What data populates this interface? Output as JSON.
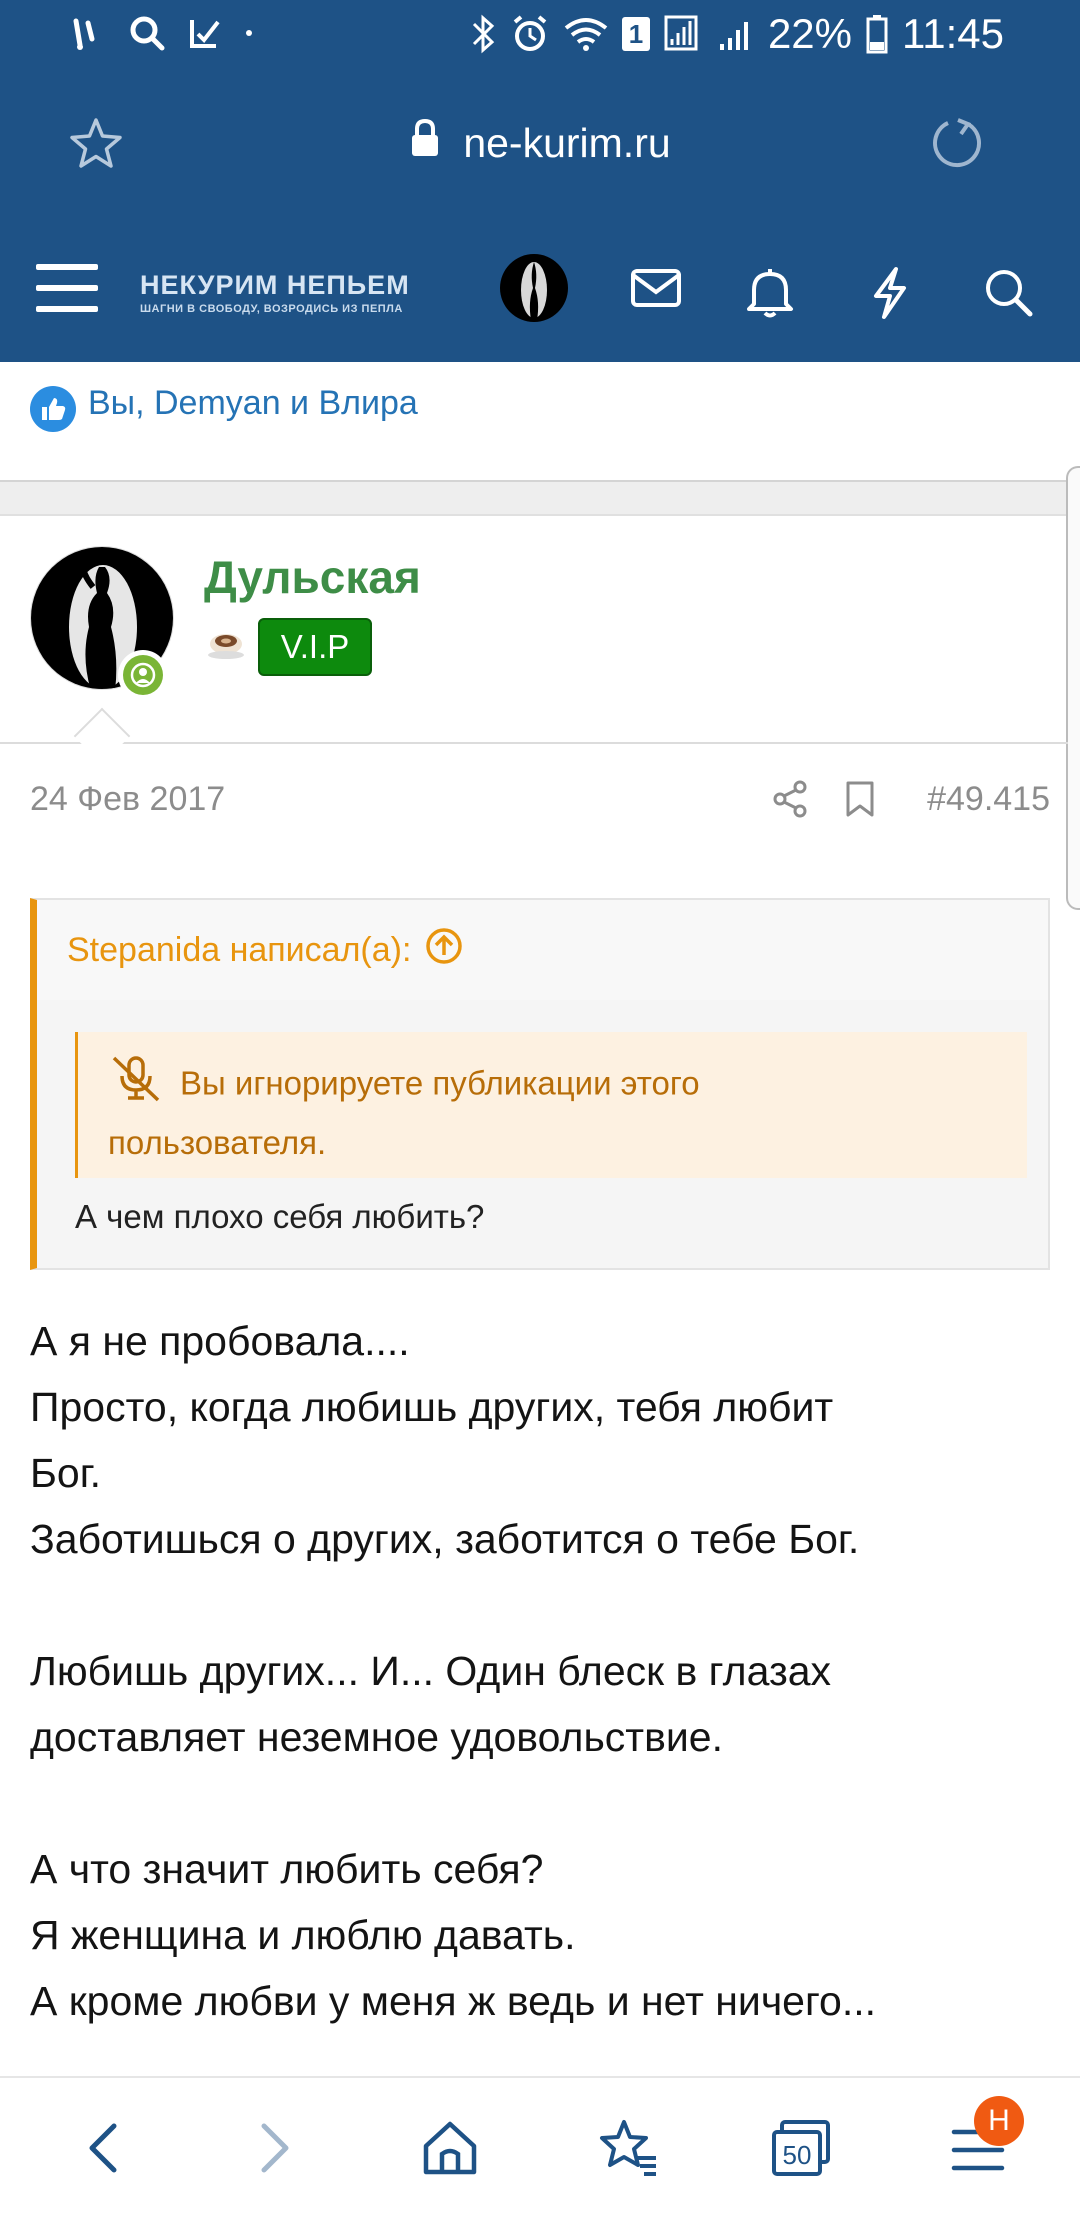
{
  "status_bar": {
    "battery": "22%",
    "time": "11:45",
    "sim_badge": "1"
  },
  "browser": {
    "url": "ne-kurim.ru"
  },
  "site": {
    "logo_title": "НЕКУРИМ НЕПЬЕМ",
    "logo_tagline": "ШАГНИ В СВОБОДУ, ВОЗРОДИСЬ ИЗ ПЕПЛА"
  },
  "reactions": {
    "text": "Вы, Demyan и Влира"
  },
  "post": {
    "author": "Дульская",
    "badge": "V.I.P",
    "date": "24 Фев 2017",
    "number": "#49.415",
    "quote": {
      "header": "Stepanida написал(а):",
      "notice_line1": "Вы игнорируете публикации этого",
      "notice_line2": "пользователя.",
      "text": "А чем плохо себя любить?"
    },
    "body": [
      "А я не пробовала....",
      "Просто, когда любишь других, тебя любит",
      "Бог.",
      "Заботишься о других, заботится о тебе Бог.",
      "",
      "Любишь других... И... Один блеск в глазах",
      "доставляет неземное удовольствие.",
      "",
      "А что значит любить себя?",
      "Я женщина и люблю давать.",
      "А кроме любви у меня ж ведь и нет ничего..."
    ]
  },
  "bottom_nav": {
    "tabs_count": "50",
    "menu_badge": "H"
  },
  "colors": {
    "header_bg": "#1e5286",
    "username": "#3e8d47",
    "vip_bg": "#0d8a0d",
    "quote_accent": "#e8950f",
    "badge": "#f05a12"
  },
  "icons": [
    "signal-icon",
    "search-icon",
    "check-icon",
    "bluetooth-icon",
    "alarm-icon",
    "wifi-icon",
    "battery-icon",
    "star-icon",
    "lock-icon",
    "reload-icon",
    "menu-icon",
    "mail-icon",
    "bell-icon",
    "bolt-icon",
    "like-icon",
    "share-icon",
    "bookmark-icon",
    "arrow-up-icon",
    "mute-icon",
    "back-icon",
    "forward-icon",
    "home-icon",
    "bookmarks-icon",
    "tabs-icon"
  ]
}
